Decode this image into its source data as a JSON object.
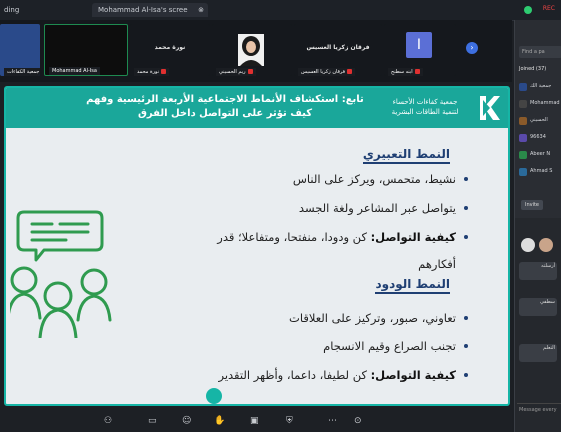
{
  "tabs": [
    {
      "label": "ding"
    },
    {
      "label": "Mohammad Al-Isa's scree"
    }
  ],
  "window": {
    "rec": "REC"
  },
  "participants": [
    {
      "name": "",
      "tag": "جمعية الكفاءات",
      "color": "#2a4a8a"
    },
    {
      "name": "",
      "tag": "Mohammad Al-Isa",
      "color": "#0d0d0d"
    },
    {
      "name": "نورة محمد",
      "tag": "نورة محمد",
      "color": "#15181d"
    },
    {
      "name": "",
      "tag": "ريم الحسيني",
      "color": "#15181d"
    },
    {
      "name": "فرقان زكريا العسيس",
      "tag": "فرقان زكريا العسيس",
      "color": "#15181d"
    },
    {
      "name": "",
      "tag": "ابنه سطنح",
      "color": "#15181d"
    }
  ],
  "participant_avatar": {
    "letter": "I"
  },
  "slide": {
    "title_line1": "تابع: استكشاف الأنماط الاجتماعية الأربعة الرئيسية وفهم",
    "title_line2": "كيف تؤثر على التواصل داخل الفرق",
    "org_line1": "جمعية كفاءات الأحساء",
    "org_line2": "لتنمية الطاقات البشرية",
    "section1": "النمط التعبيري",
    "s1_b1": "نشيط، متحمس، ويركز على الناس",
    "s1_b2": "يتواصل عبر المشاعر ولغة الجسد",
    "s1_b3_bold": "كيفية التواصل:",
    "s1_b3_rest": " كن ودودا، منفتحا، ومتفاعلا؛ قدر",
    "s1_b3_cont": "أفكارهم",
    "section2": "النمط الودود",
    "s2_b1": "تعاوني، صبور، وتركيز على العلاقات",
    "s2_b2": "تجنب الصراع وقيم الانسجام",
    "s2_b3_bold": "كيفية التواصل:",
    "s2_b3_rest": " كن لطيفا، داعما، وأظهر التقدير"
  },
  "panel": {
    "search": "Find a pa",
    "joined": "Joined (37)",
    "rows": [
      {
        "text": "جمعية الك",
        "color": "#2a4a8a"
      },
      {
        "text": "Mohammad",
        "color": "#444"
      },
      {
        "text": "الحسيني",
        "color": "#8a5a2a"
      },
      {
        "text": "96634",
        "color": "#5a4aaa"
      },
      {
        "text": "Abeer N",
        "color": "#2a8a4a"
      },
      {
        "text": "Ahmad S",
        "color": "#2a6a9a"
      }
    ],
    "invite": "Invite",
    "messages": [
      {
        "text": "أرسلته"
      },
      {
        "text": "سطفي"
      },
      {
        "text": "التعلم"
      }
    ],
    "composer": "Message every"
  },
  "toolbar": {
    "icons": [
      "mic-icon",
      "camera-icon",
      "chat-icon",
      "raise-hand-icon",
      "share-icon",
      "settings-icon"
    ]
  }
}
